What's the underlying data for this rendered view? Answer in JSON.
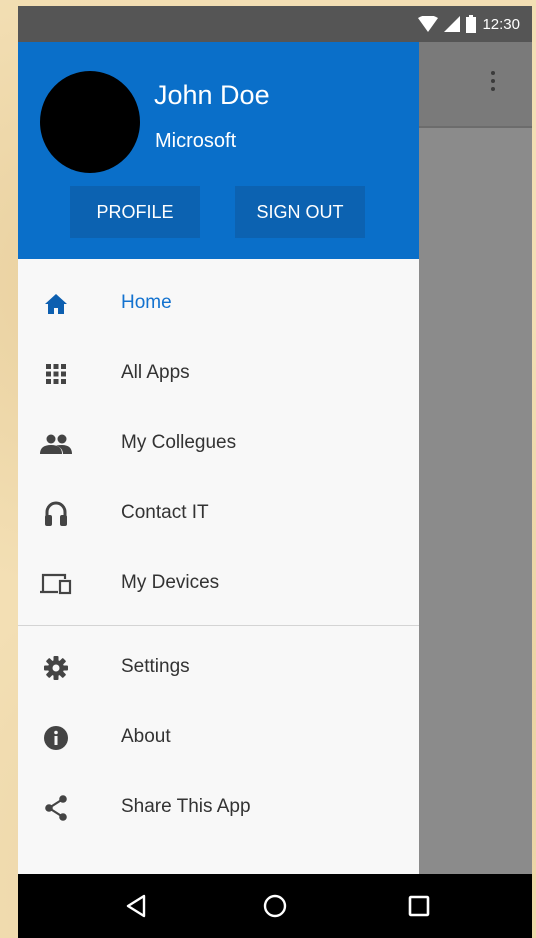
{
  "status_bar": {
    "time": "12:30",
    "icons": [
      "wifi-icon",
      "signal-icon",
      "battery-icon"
    ]
  },
  "header": {
    "name": "John Doe",
    "organization": "Microsoft",
    "profile_label": "PROFILE",
    "signout_label": "SIGN OUT",
    "accent_color": "#0a6fc9"
  },
  "menu": {
    "items": [
      {
        "label": "Home",
        "icon": "home-icon",
        "active": true
      },
      {
        "label": "All Apps",
        "icon": "apps-grid-icon"
      },
      {
        "label": "My Collegues",
        "icon": "people-icon"
      },
      {
        "label": "Contact IT",
        "icon": "headset-icon"
      },
      {
        "label": "My Devices",
        "icon": "devices-icon"
      }
    ],
    "secondary": [
      {
        "label": "Settings",
        "icon": "gear-icon"
      },
      {
        "label": "About",
        "icon": "info-icon"
      },
      {
        "label": "Share This App",
        "icon": "share-icon"
      }
    ]
  },
  "nav_bar": {
    "buttons": [
      "back-icon",
      "home-circle-icon",
      "recents-icon"
    ]
  }
}
